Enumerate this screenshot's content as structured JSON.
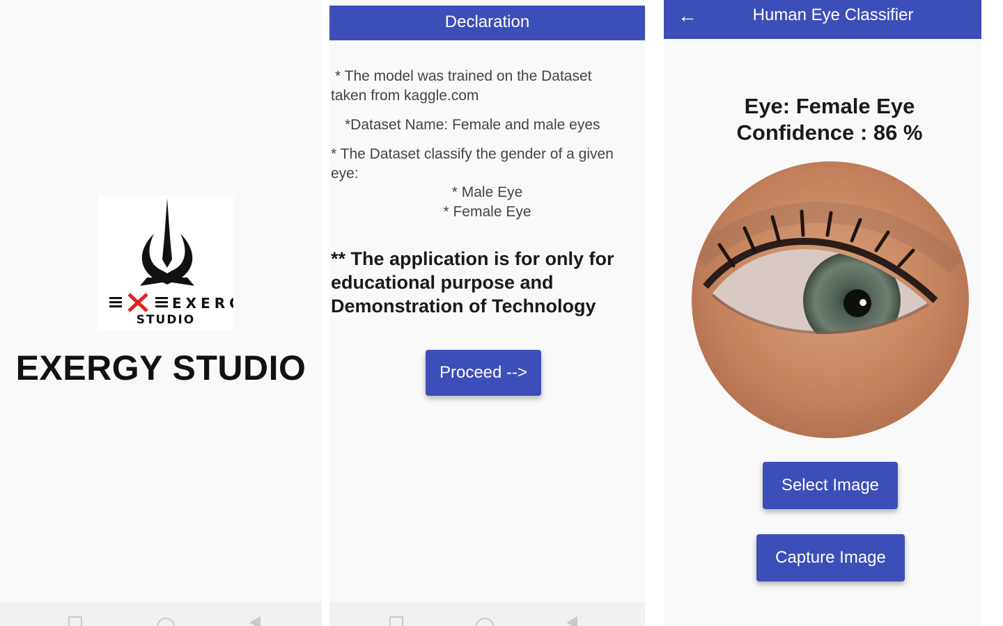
{
  "splash": {
    "brand_title": "EXERGY STUDIO",
    "logo_text_main": "EXERGY",
    "logo_text_sub": "STUDIO"
  },
  "declaration": {
    "title": "Declaration",
    "line1": "* The model was trained on the Dataset taken from kaggle.com",
    "line2": "*Dataset Name: Female and male eyes",
    "line3": "* The Dataset classify the gender of a given eye:",
    "bullets": [
      "* Male Eye",
      "* Female Eye"
    ],
    "notice": "** The application is for only for educational purpose and Demonstration of Technology",
    "proceed_label": "Proceed -->"
  },
  "classifier": {
    "title": "Human Eye Classifier",
    "back_icon": "arrow-left-icon",
    "result_eye": "Eye: Female Eye",
    "result_confidence": "Confidence : 86 %",
    "select_label": "Select Image",
    "capture_label": "Capture Image"
  },
  "colors": {
    "primary": "#3c4fb8",
    "background": "#f9f9f9",
    "text_dark": "#1a1a1a",
    "text_body": "#444444"
  }
}
